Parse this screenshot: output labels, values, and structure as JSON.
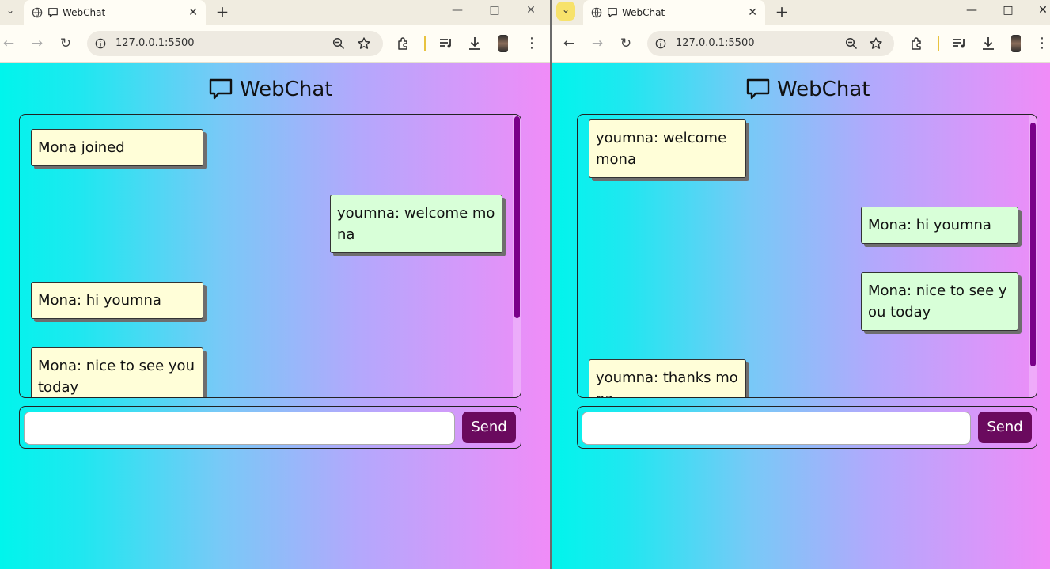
{
  "colors": {
    "accent": "#6a0a5e",
    "scrollbar": "#7a008a",
    "received_bubble": "#fffed8",
    "sent_bubble": "#d8ffd8"
  },
  "left_window": {
    "tab_title": "WebChat",
    "new_tab_label": "+",
    "url": "127.0.0.1:5500",
    "window_controls": {
      "minimize": "—",
      "maximize": "□",
      "close": "✕"
    },
    "app_title": "WebChat",
    "messages": [
      {
        "text": "Mona joined",
        "side": "left"
      },
      {
        "text": "youmna: welcome mona",
        "side": "right"
      },
      {
        "text": "Mona: hi youmna",
        "side": "left"
      },
      {
        "text": "Mona: nice to see you today",
        "side": "left"
      }
    ],
    "input_value": "",
    "send_label": "Send"
  },
  "right_window": {
    "tab_title": "WebChat",
    "new_tab_label": "+",
    "url": "127.0.0.1:5500",
    "window_controls": {
      "minimize": "—",
      "maximize": "□",
      "close": "✕"
    },
    "app_title": "WebChat",
    "messages": [
      {
        "text": "youmna: welcome mona",
        "side": "left"
      },
      {
        "text": "Mona: hi youmna",
        "side": "right"
      },
      {
        "text": "Mona: nice to see you today",
        "side": "right"
      },
      {
        "text": "youmna: thanks mona",
        "side": "left"
      }
    ],
    "input_value": "",
    "send_label": "Send"
  }
}
